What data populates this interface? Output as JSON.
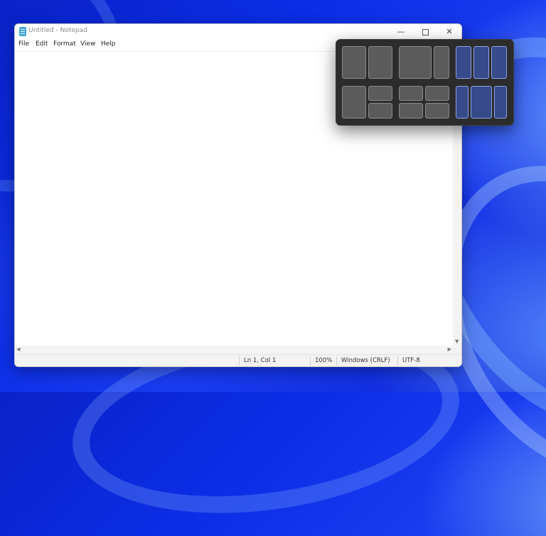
{
  "window": {
    "title": "Untitled - Notepad",
    "controls": {
      "minimize": "—",
      "close": "✕"
    }
  },
  "menu": [
    "File",
    "Edit",
    "Format",
    "View",
    "Help"
  ],
  "editor": {
    "content": ""
  },
  "status": {
    "position": "Ln 1, Col 1",
    "zoom": "100%",
    "line_ending": "Windows (CRLF)",
    "encoding": "UTF-8"
  },
  "snap_layouts": {
    "layouts": [
      {
        "name": "two-equal",
        "zones": 2
      },
      {
        "name": "two-wide-left",
        "zones": 2
      },
      {
        "name": "three-columns",
        "zones": 3
      },
      {
        "name": "left-plus-two-stacked",
        "zones": 3
      },
      {
        "name": "four-grid",
        "zones": 4
      },
      {
        "name": "wide-center-three",
        "zones": 3
      }
    ]
  },
  "colors": {
    "desktop": "#0b2ee6",
    "flyout": "#2c2c2c",
    "zone": "#5b5b5b",
    "zone_highlight": "#4164d7"
  },
  "icons": {
    "app": "notepad-icon",
    "maximize": "maximize-icon"
  }
}
